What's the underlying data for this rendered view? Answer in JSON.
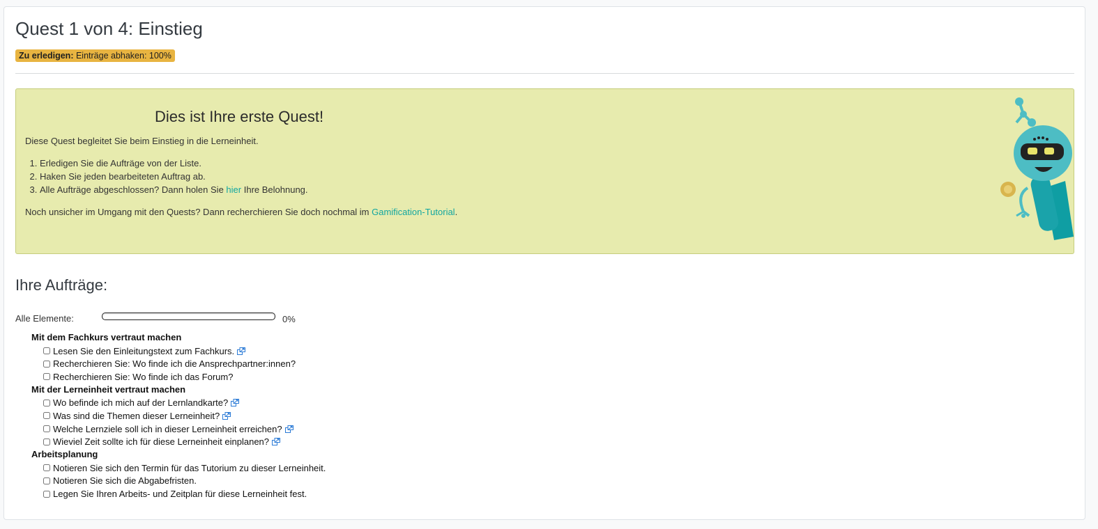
{
  "quest": {
    "title": "Quest 1 von 4: Einstieg",
    "badge_label": "Zu erledigen:",
    "badge_text": "Einträge abhaken: 100%",
    "badge_color": "#e8b441"
  },
  "intro": {
    "heading": "Dies ist Ihre erste Quest!",
    "text": "Diese Quest begleitet Sie beim Einstieg in die Lerneinheit.",
    "step1": "Erledigen Sie die Aufträge von der Liste.",
    "step2": "Haken Sie jeden bearbeiteten Auftrag ab.",
    "step3_before": "Alle Aufträge abgeschlossen? Dann holen Sie ",
    "step3_link": "hier",
    "step3_after": " Ihre Belohnung.",
    "note_before": "Noch unsicher im Umgang mit den Quests? Dann recherchieren Sie doch nochmal im ",
    "note_link": "Gamification-Tutorial",
    "note_after": ".",
    "background_color": "#e7ebae",
    "link_color": "#12a6a0",
    "mascot_icon": "robot-mascot"
  },
  "tasks": {
    "heading": "Ihre Aufträge:",
    "progress_label": "Alle Elemente:",
    "progress_value": 0,
    "progress_text": "0%",
    "external_link_icon": "external-link-icon",
    "groups": [
      {
        "title": "Mit dem Fachkurs vertraut machen",
        "items": [
          {
            "label": "Lesen Sie den Einleitungstext zum Fachkurs.",
            "link": true,
            "checked": false
          },
          {
            "label": "Recherchieren Sie: Wo finde ich die Ansprechpartner:innen?",
            "link": false,
            "checked": false
          },
          {
            "label": "Recherchieren Sie: Wo finde ich das Forum?",
            "link": false,
            "checked": false
          }
        ]
      },
      {
        "title": "Mit der Lerneinheit vertraut machen",
        "items": [
          {
            "label": "Wo befinde ich mich auf der Lernlandkarte?",
            "link": true,
            "checked": false
          },
          {
            "label": "Was sind die Themen dieser Lerneinheit?",
            "link": true,
            "checked": false
          },
          {
            "label": "Welche Lernziele soll ich in dieser Lerneinheit erreichen?",
            "link": true,
            "checked": false
          },
          {
            "label": "Wieviel Zeit sollte ich für diese Lerneinheit einplanen?",
            "link": true,
            "checked": false
          }
        ]
      },
      {
        "title": "Arbeitsplanung",
        "items": [
          {
            "label": "Notieren Sie sich den Termin für das Tutorium zu dieser Lerneinheit.",
            "link": false,
            "checked": false
          },
          {
            "label": "Notieren Sie sich die Abgabefristen.",
            "link": false,
            "checked": false
          },
          {
            "label": "Legen Sie Ihren Arbeits- und Zeitplan für diese Lerneinheit fest.",
            "link": false,
            "checked": false
          }
        ]
      }
    ]
  }
}
